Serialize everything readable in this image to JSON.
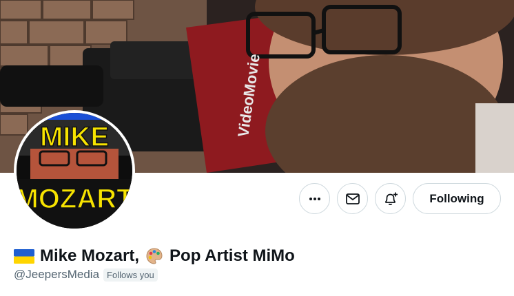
{
  "banner": {
    "camera_brand_text": "VideoMovie"
  },
  "avatar": {
    "top_text": "MIKE",
    "bottom_text": "MOZART"
  },
  "actions": {
    "more_icon": "more-horizontal-icon",
    "message_icon": "envelope-icon",
    "notify_icon": "bell-plus-icon",
    "follow_label": "Following"
  },
  "profile": {
    "display_name_part1": "Mike Mozart,",
    "display_name_part2": "Pop Artist MiMo",
    "handle": "@JeepersMedia",
    "follows_you": "Follows you"
  },
  "colors": {
    "flag_blue": "#1f5fd1",
    "flag_yellow": "#ffd500",
    "avatar_yellow": "#f7e300"
  }
}
